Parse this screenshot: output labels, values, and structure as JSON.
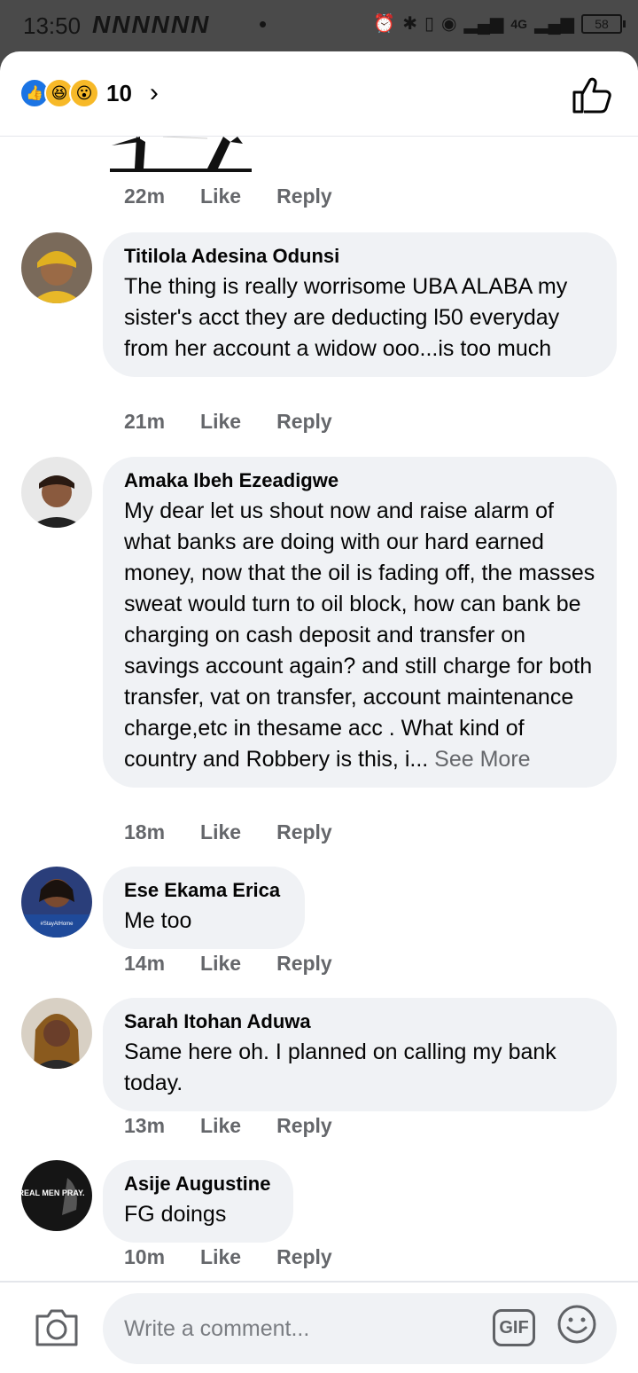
{
  "status_bar": {
    "time": "13:50",
    "carrier": "NNNNNN",
    "network": "4G",
    "battery": "58"
  },
  "header": {
    "reaction_count": "10",
    "reactions": [
      "like-icon",
      "haha-icon",
      "wow-icon"
    ]
  },
  "first_meta": {
    "time": "22m",
    "like": "Like",
    "reply": "Reply"
  },
  "comments": [
    {
      "author": "Titilola Adesina Odunsi",
      "text": "The thing is really worrisome UBA ALABA my sister's acct they are deducting l50 everyday from her account a widow ooo...is too much",
      "time": "21m",
      "like": "Like",
      "reply": "Reply"
    },
    {
      "author": "Amaka Ibeh Ezeadigwe",
      "text": "My dear let us shout  now and raise alarm of what banks are doing with our hard earned  money,  now that the oil is fading off, the masses  sweat would turn to oil block, how can  bank be charging on cash deposit  and transfer on savings  account again? and still charge for both transfer, vat on transfer, account maintenance charge,etc in thesame acc . What kind of country and Robbery  is this, i...",
      "see_more": "See More",
      "time": "18m",
      "like": "Like",
      "reply": "Reply"
    },
    {
      "author": "Ese Ekama Erica",
      "text": "Me too",
      "avatar_caption": "#StayAtHome",
      "time": "14m",
      "like": "Like",
      "reply": "Reply"
    },
    {
      "author": "Sarah Itohan Aduwa",
      "text": "Same here oh. I planned on calling my bank today.",
      "time": "13m",
      "like": "Like",
      "reply": "Reply"
    },
    {
      "author": "Asije Augustine",
      "text": "FG doings",
      "avatar_caption": "REAL MEN PRAY.",
      "time": "10m",
      "like": "Like",
      "reply": "Reply"
    }
  ],
  "composer": {
    "placeholder": "Write a comment...",
    "gif_label": "GIF"
  }
}
